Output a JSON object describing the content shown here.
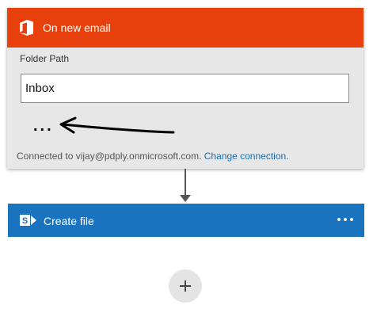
{
  "trigger": {
    "title": "On new email",
    "icon": "office-icon",
    "header_color": "#e8400c",
    "folder_label": "Folder Path",
    "folder_value": "Inbox",
    "more_label": "...",
    "connection_text": "Connected to vijay@pdply.onmicrosoft.com.",
    "change_connection_label": "Change connection."
  },
  "action": {
    "title": "Create file",
    "icon": "sharepoint-icon",
    "header_color": "#1a73be",
    "menu_icon": "more-options-icon"
  },
  "add_step": {
    "icon": "plus-icon"
  },
  "annotation": {
    "icon": "hand-drawn-arrow-icon"
  }
}
